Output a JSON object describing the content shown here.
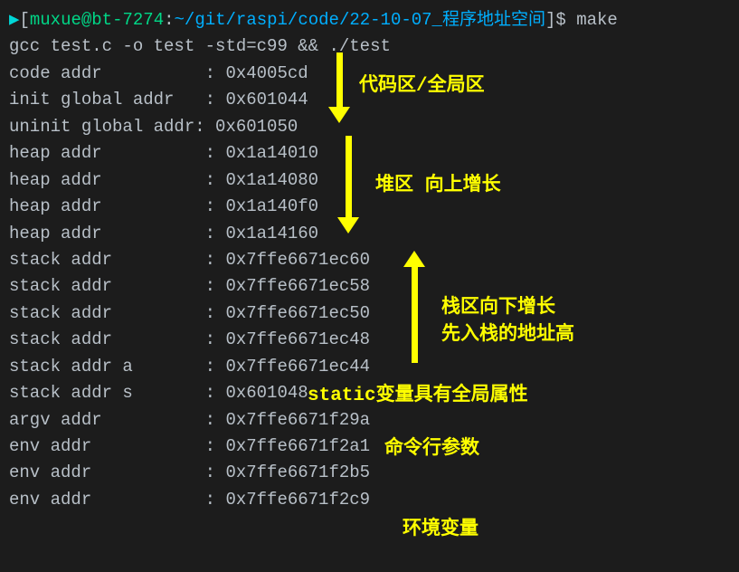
{
  "prompt": {
    "arrow": "▶",
    "open_br": "[",
    "user": "muxue",
    "at": "@",
    "host": "bt-7274",
    "colon": ":",
    "path": "~/git/raspi/code/22-10-07_",
    "path_cjk": "程序地址空间",
    "close_br": "]$",
    "cmd": "make"
  },
  "lines": [
    "gcc test.c -o test -std=c99 && ./test",
    "code addr          : 0x4005cd",
    "init global addr   : 0x601044",
    "uninit global addr: 0x601050",
    "heap addr          : 0x1a14010",
    "heap addr          : 0x1a14080",
    "heap addr          : 0x1a140f0",
    "heap addr          : 0x1a14160",
    "stack addr         : 0x7ffe6671ec60",
    "stack addr         : 0x7ffe6671ec58",
    "stack addr         : 0x7ffe6671ec50",
    "stack addr         : 0x7ffe6671ec48",
    "stack addr a       : 0x7ffe6671ec44",
    "stack addr s       : 0x601048",
    "",
    "argv addr          : 0x7ffe6671f29a",
    "",
    "env addr           : 0x7ffe6671f2a1",
    "env addr           : 0x7ffe6671f2b5",
    "env addr           : 0x7ffe6671f2c9"
  ],
  "annotations": {
    "code_global": "代码区/全局区",
    "heap": "堆区 向上增长",
    "stack1": "栈区向下增长",
    "stack2": "先入栈的地址高",
    "static_var": "static变量具有全局属性",
    "argv": "命令行参数",
    "env": "环境变量"
  }
}
